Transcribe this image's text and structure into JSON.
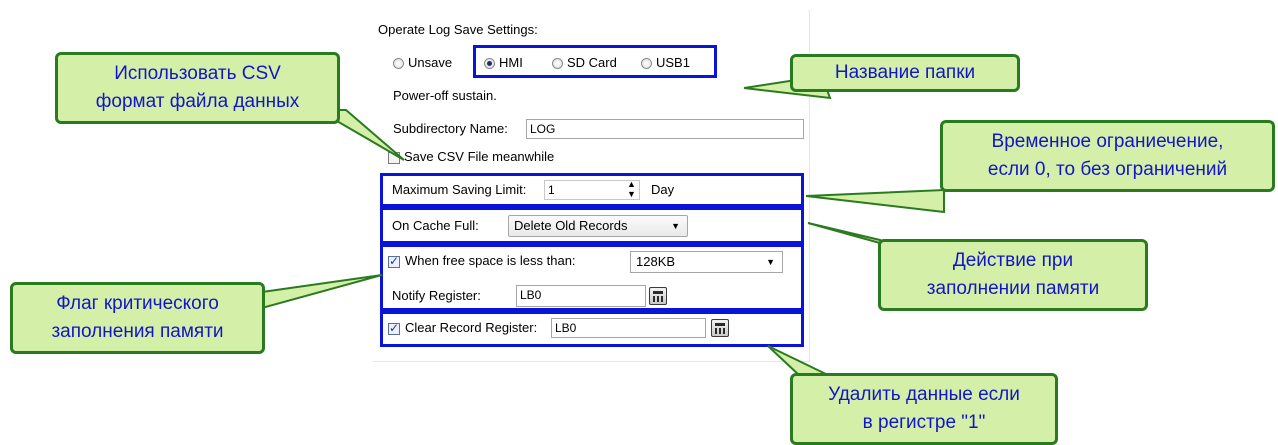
{
  "panel": {
    "title": "Operate Log Save Settings:",
    "radio_options": [
      {
        "label": "Unsave",
        "selected": false
      },
      {
        "label": "HMI",
        "selected": true
      },
      {
        "label": "SD Card",
        "selected": false
      },
      {
        "label": "USB1",
        "selected": false
      }
    ],
    "power_off_text": "Power-off sustain.",
    "subdirectory_label": "Subdirectory Name:",
    "subdirectory_value": "LOG",
    "save_csv_label": "Save CSV File meanwhile",
    "save_csv_checked": false,
    "max_limit_label": "Maximum Saving Limit:",
    "max_limit_value": "1",
    "max_limit_unit": "Day",
    "cache_full_label": "On Cache Full:",
    "cache_full_value": "Delete Old Records",
    "free_space_label": "When free space is less than:",
    "free_space_checked": true,
    "free_space_value": "128KB",
    "notify_label": "Notify Register:",
    "notify_value": "LB0",
    "clear_label": "Clear Record Register:",
    "clear_checked": true,
    "clear_value": "LB0"
  },
  "callouts": {
    "csv": "Использовать CSV\nформат файла данных",
    "folder": "Название папки",
    "time_limit": "Временное ограниечение,\nесли 0, то без ограничений",
    "action": "Действие при\nзаполнении памяти",
    "flag": "Флаг критического\nзаполнения памяти",
    "delete": "Удалить данные если\nв регистре \"1\""
  },
  "colors": {
    "frame": "#0a14d8",
    "callout_fill": "#d4f0a8",
    "callout_border": "#2a7a20",
    "callout_text": "#1414c8"
  }
}
